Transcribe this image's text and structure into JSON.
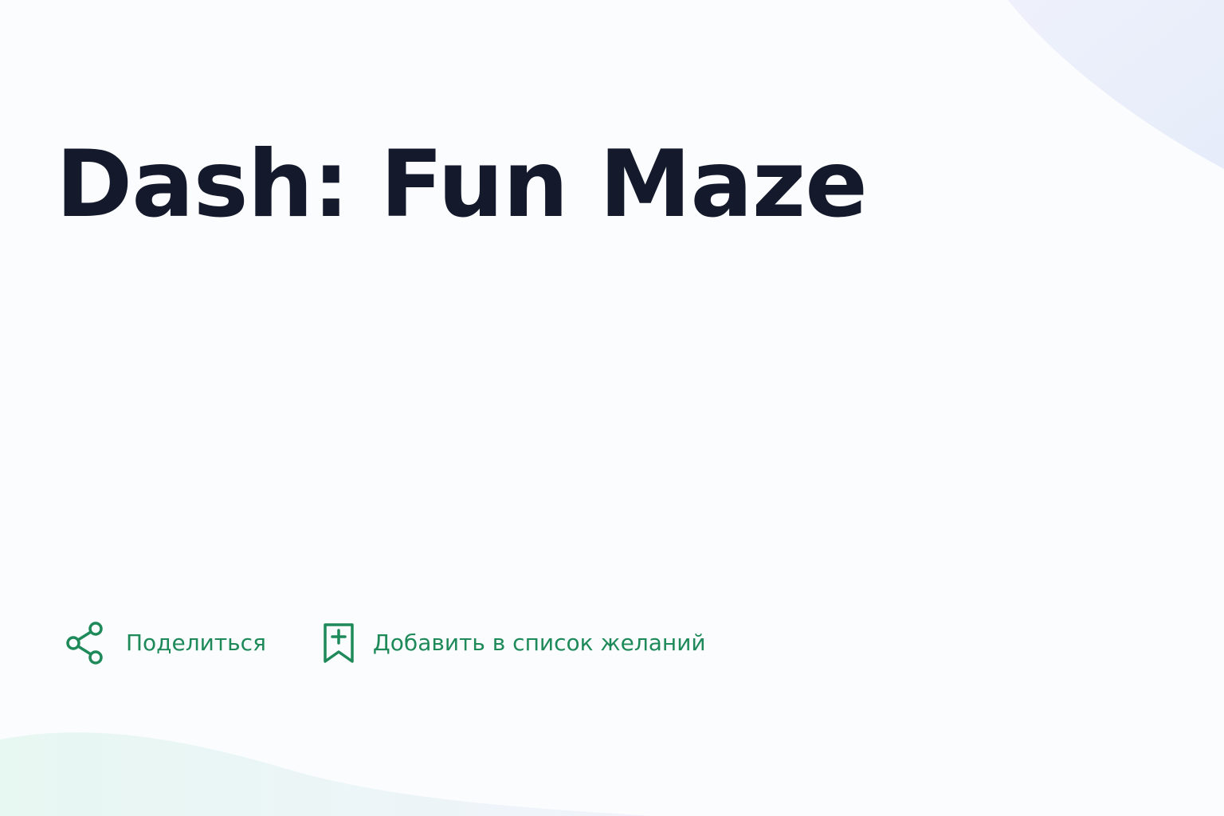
{
  "app": {
    "title": "Dash: Fun Maze"
  },
  "actions": {
    "share_label": "Поделиться",
    "share_icon": "share-icon",
    "wishlist_label": "Добавить в список желаний",
    "wishlist_icon": "bookmark-add-icon"
  },
  "colors": {
    "title": "#141a2c",
    "accent": "#1e8a59",
    "background": "#fbfcfe"
  }
}
